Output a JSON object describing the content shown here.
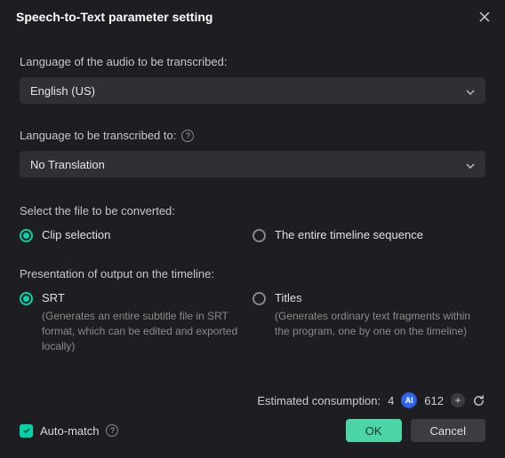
{
  "header": {
    "title": "Speech-to-Text parameter setting"
  },
  "language_source": {
    "label": "Language of the audio to be transcribed:",
    "value": "English (US)"
  },
  "language_target": {
    "label": "Language to be transcribed to:",
    "value": "No Translation"
  },
  "file_select": {
    "label": "Select the file to be converted:",
    "options": [
      {
        "label": "Clip selection",
        "checked": true
      },
      {
        "label": "The entire timeline sequence",
        "checked": false
      }
    ]
  },
  "presentation": {
    "label": "Presentation of output on the timeline:",
    "options": [
      {
        "label": "SRT",
        "desc": "(Generates an entire subtitle file in SRT format, which can be edited and exported locally)",
        "checked": true
      },
      {
        "label": "Titles",
        "desc": "(Generates ordinary text fragments within the program, one by one on the timeline)",
        "checked": false
      }
    ]
  },
  "consumption": {
    "label": "Estimated consumption:",
    "value": "4",
    "credits": "612"
  },
  "auto_match": {
    "label": "Auto-match",
    "checked": true
  },
  "buttons": {
    "ok": "OK",
    "cancel": "Cancel"
  }
}
